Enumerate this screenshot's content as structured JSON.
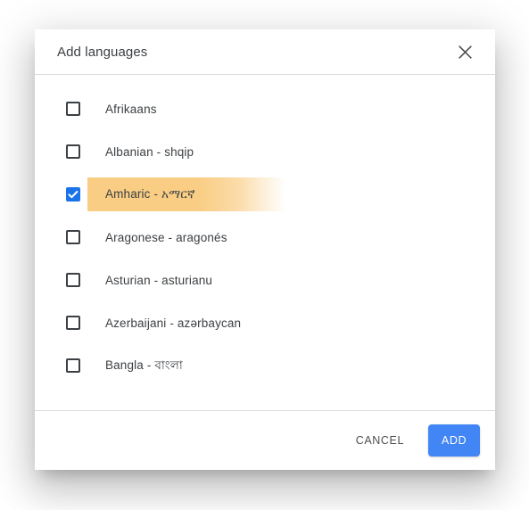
{
  "dialog": {
    "title": "Add languages",
    "close_icon": "close-icon"
  },
  "colors": {
    "accent_blue": "#4285f4",
    "checkbox_checked": "#1a73e8",
    "highlight_orange": "#f9cd84",
    "text": "#3c4043",
    "divider": "#dcdcdc"
  },
  "languages": [
    {
      "label": "Afrikaans",
      "checked": false
    },
    {
      "label": "Albanian - shqip",
      "checked": false
    },
    {
      "label": "Amharic - አማርኛ",
      "checked": true
    },
    {
      "label": "Aragonese - aragonés",
      "checked": false
    },
    {
      "label": "Asturian - asturianu",
      "checked": false
    },
    {
      "label": "Azerbaijani - azərbaycan",
      "checked": false
    },
    {
      "label": "Bangla - বাংলা",
      "checked": false
    }
  ],
  "footer": {
    "cancel_label": "CANCEL",
    "add_label": "ADD"
  }
}
